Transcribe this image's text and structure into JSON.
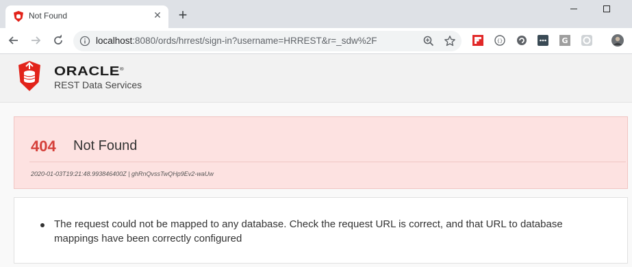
{
  "browser": {
    "tab": {
      "title": "Not Found",
      "close_glyph": "✕",
      "favicon": "shield-icon"
    },
    "new_tab_glyph": "+",
    "window_controls": [
      "minimize-icon",
      "maximize-icon"
    ],
    "address": {
      "host": "localhost",
      "rest": ":8080/ords/hrrest/sign-in?username=HRREST&r=_sdw%2F"
    },
    "toolbar_icons": [
      "back-icon",
      "forward-icon",
      "reload-icon",
      "info-icon",
      "zoom-icon",
      "star-icon"
    ],
    "extensions": [
      "flipboard-icon",
      "braces-icon",
      "circle-arrow-icon",
      "dots-icon",
      "g-icon",
      "refresh-icon",
      "profile-avatar"
    ]
  },
  "header": {
    "brand": "ORACLE",
    "trademark": "®",
    "product": "REST Data Services",
    "logo": "shield-database-icon"
  },
  "error": {
    "code": "404",
    "title": "Not Found",
    "meta": "2020-01-03T19:21:48.993846400Z | ghRnQvssTwQHp9Ev2-waUw"
  },
  "messages": [
    "The request could not be mapped to any database. Check the request URL is correct, and that URL to database mappings have been correctly configured"
  ],
  "colors": {
    "error_accent": "#d5403a",
    "error_panel_bg": "#fde2e1",
    "oracle_red": "#e2231a"
  }
}
